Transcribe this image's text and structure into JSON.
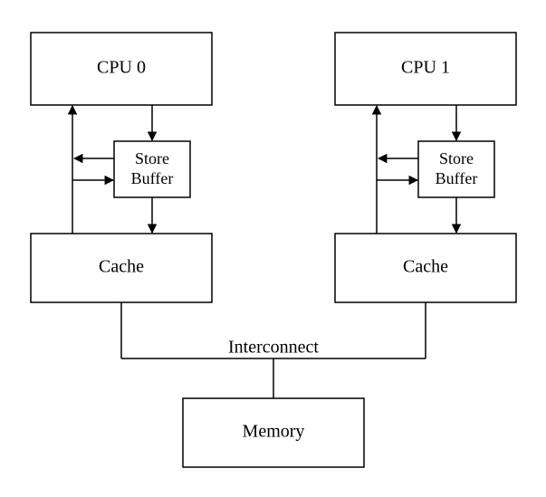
{
  "nodes": {
    "cpu0": "CPU 0",
    "cpu1": "CPU 1",
    "store0_a": "Store",
    "store0_b": "Buffer",
    "store1_a": "Store",
    "store1_b": "Buffer",
    "cache0": "Cache",
    "cache1": "Cache",
    "interconnect": "Interconnect",
    "memory": "Memory"
  }
}
